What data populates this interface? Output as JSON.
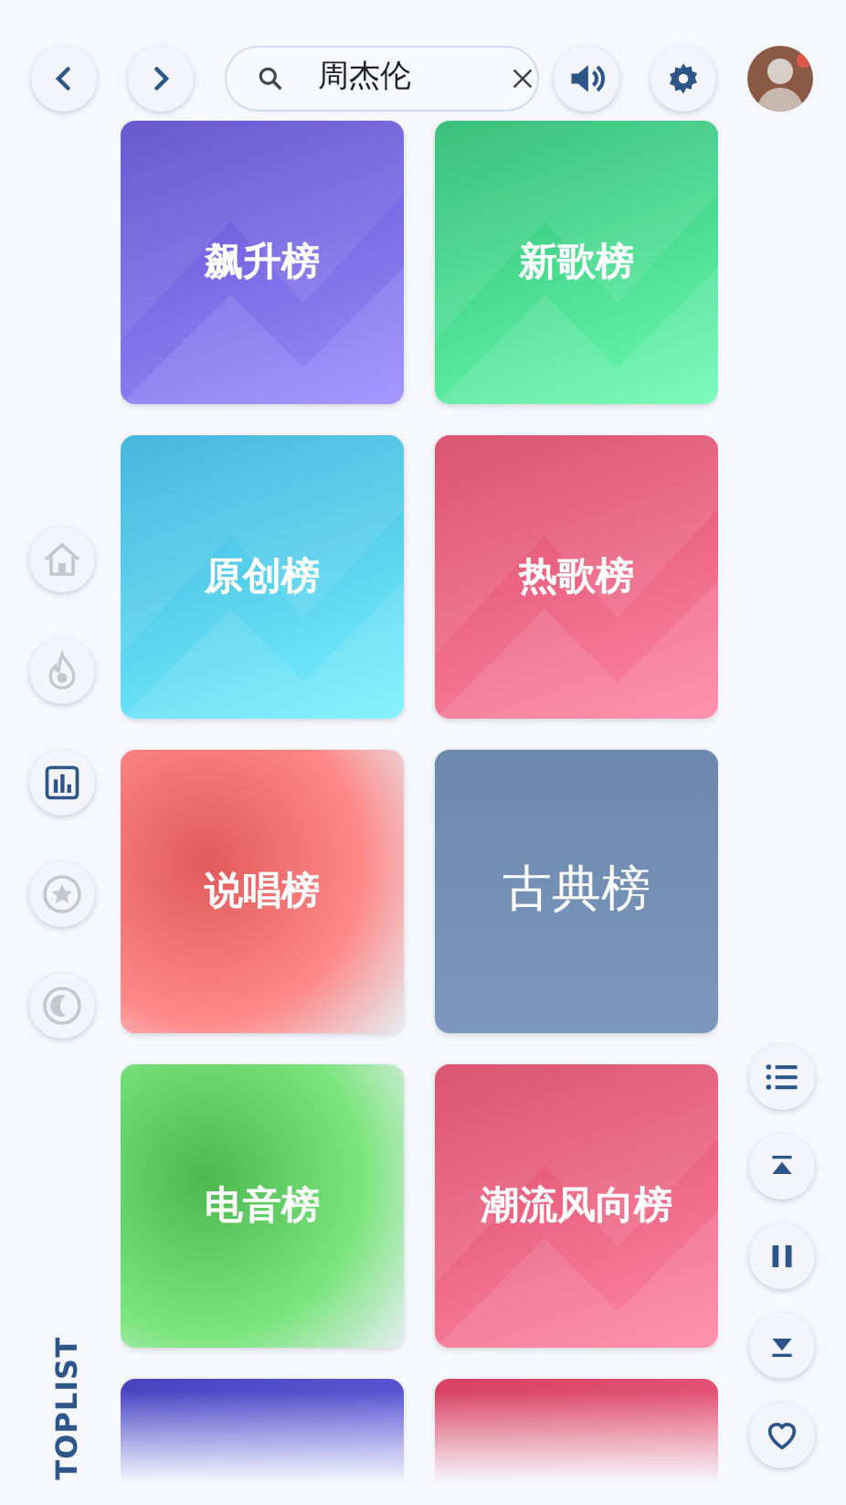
{
  "search": {
    "value": "周杰伦"
  },
  "sidebar": {
    "items": [
      {
        "selected": false
      },
      {
        "selected": false
      },
      {
        "selected": true
      },
      {
        "selected": false
      },
      {
        "selected": false
      }
    ],
    "label": "TOPLIST"
  },
  "cards": [
    {
      "title": "飙升榜",
      "kind": "wave",
      "color": "#6f5fe0"
    },
    {
      "title": "新歌榜",
      "kind": "wave",
      "color": "#3fcf84"
    },
    {
      "title": "原创榜",
      "kind": "wave",
      "color": "#4cc4ee"
    },
    {
      "title": "热歌榜",
      "kind": "wave",
      "color": "#ec5a78"
    },
    {
      "title": "说唱榜",
      "kind": "blur",
      "color": "#ef6a6a"
    },
    {
      "title": "古典榜",
      "kind": "plain",
      "color": "#6c88ad"
    },
    {
      "title": "电音榜",
      "kind": "blur",
      "color": "#5cc75e"
    },
    {
      "title": "潮流风向榜",
      "kind": "wave",
      "color": "#ec5a78"
    },
    {
      "kind": "wave",
      "color": "#4c48cf"
    },
    {
      "kind": "wave",
      "color": "#e8456a"
    }
  ]
}
